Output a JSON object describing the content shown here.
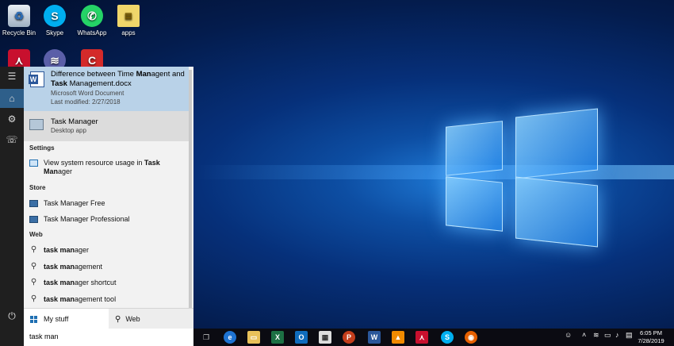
{
  "desktop": {
    "icons": [
      {
        "label": "Recycle Bin"
      },
      {
        "label": "Skype"
      },
      {
        "label": "WhatsApp"
      },
      {
        "label": "apps"
      }
    ]
  },
  "start_rail": {
    "menu_icon": "hamburger-icon",
    "home_icon": "home-icon",
    "settings_icon": "gear-icon",
    "feedback_icon": "feedback-icon",
    "power_icon": "power-icon"
  },
  "results": {
    "best_match": {
      "title_part1": "Difference between Time ",
      "title_bold1": "Man",
      "title_part2": "agent and",
      "title_bold2": "Task",
      "title_part3": " Management.docx",
      "type": "Microsoft Word Document",
      "modified": "Last modified: 2/27/2018"
    },
    "app": {
      "title": "Task Manager",
      "subtitle": "Desktop app"
    },
    "sections": {
      "settings": "Settings",
      "store": "Store",
      "web": "Web"
    },
    "settings_item": {
      "line1_normal": "View system resource usage in ",
      "line1_bold": "Task",
      "line2_bold": "Man",
      "line2_normal": "ager"
    },
    "store_items": [
      "Task Manager Free",
      "Task Manager Professional"
    ],
    "web_items": [
      {
        "bold": "task man",
        "rest": "ager"
      },
      {
        "bold": "task man",
        "rest": "agement"
      },
      {
        "bold": "task man",
        "rest": "ager shortcut"
      },
      {
        "bold": "task man",
        "rest": "agement tool"
      }
    ]
  },
  "tabs": {
    "my_stuff": "My stuff",
    "web": "Web"
  },
  "search": {
    "query": "task man"
  },
  "clock": {
    "time": "6:05 PM",
    "date": "7/28/2019"
  },
  "colors": {
    "selection": "#b9d2e8",
    "accent": "#1f6fb2"
  }
}
